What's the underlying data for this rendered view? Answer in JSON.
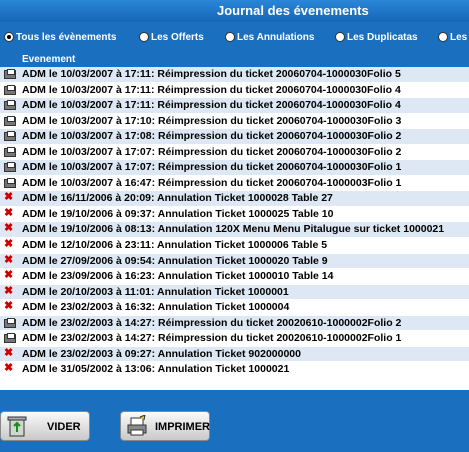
{
  "window": {
    "title": "Journal des évenements"
  },
  "filters": [
    {
      "label": "Tous les évènements",
      "selected": true
    },
    {
      "label": "Les Offerts",
      "selected": false
    },
    {
      "label": "Les Annulations",
      "selected": false
    },
    {
      "label": "Les Duplicatas",
      "selected": false
    },
    {
      "label": "Les",
      "selected": false
    }
  ],
  "list": {
    "header": "Evenement",
    "rows": [
      {
        "icon": "printer-icon",
        "text": "ADM le 10/03/2007 à 17:11: Réimpression du ticket 20060704-1000030Folio 5"
      },
      {
        "icon": "printer-icon",
        "text": "ADM le 10/03/2007 à 17:11: Réimpression du ticket 20060704-1000030Folio 4"
      },
      {
        "icon": "printer-icon",
        "text": "ADM le 10/03/2007 à 17:11: Réimpression du ticket 20060704-1000030Folio 4"
      },
      {
        "icon": "printer-icon",
        "text": "ADM le 10/03/2007 à 17:10: Réimpression du ticket 20060704-1000030Folio 3"
      },
      {
        "icon": "printer-icon",
        "text": "ADM le 10/03/2007 à 17:08: Réimpression du ticket 20060704-1000030Folio 2"
      },
      {
        "icon": "printer-icon",
        "text": "ADM le 10/03/2007 à 17:07: Réimpression du ticket 20060704-1000030Folio 2"
      },
      {
        "icon": "printer-icon",
        "text": "ADM le 10/03/2007 à 17:07: Réimpression du ticket 20060704-1000030Folio 1"
      },
      {
        "icon": "printer-icon",
        "text": "ADM le 10/03/2007 à 16:47: Réimpression du ticket 20060704-1000003Folio 1"
      },
      {
        "icon": "cross-icon",
        "text": "ADM le 16/11/2006 à 20:09: Annulation Ticket 1000028 Table 27"
      },
      {
        "icon": "cross-icon",
        "text": "ADM le 19/10/2006 à 09:37: Annulation Ticket 1000025 Table 10"
      },
      {
        "icon": "cross-icon",
        "text": "ADM le 19/10/2006 à 08:13: Annulation 120X Menu Menu Pitalugue sur ticket 1000021"
      },
      {
        "icon": "cross-icon",
        "text": "ADM le 12/10/2006 à 23:11: Annulation Ticket 1000006 Table 5"
      },
      {
        "icon": "cross-icon",
        "text": "ADM le 27/09/2006 à 09:54: Annulation Ticket 1000020 Table 9"
      },
      {
        "icon": "cross-icon",
        "text": "ADM le 23/09/2006 à 16:23: Annulation Ticket 1000010 Table 14"
      },
      {
        "icon": "cross-icon",
        "text": "ADM le 20/10/2003 à 11:01: Annulation Ticket 1000001"
      },
      {
        "icon": "cross-icon",
        "text": "ADM le 23/02/2003 à 16:32: Annulation Ticket 1000004"
      },
      {
        "icon": "printer-icon",
        "text": "ADM le 23/02/2003 à 14:27: Réimpression du ticket 20020610-1000002Folio 2"
      },
      {
        "icon": "printer-icon",
        "text": "ADM le 23/02/2003 à 14:27: Réimpression du ticket 20020610-1000002Folio 1"
      },
      {
        "icon": "cross-icon",
        "text": "ADM le 23/02/2003 à 09:27: Annulation Ticket 902000000"
      },
      {
        "icon": "cross-icon",
        "text": "ADM le 31/05/2002 à 13:06: Annulation Ticket 1000021"
      }
    ]
  },
  "buttons": {
    "clear_label": "VIDER",
    "print_label": "IMPRIMER"
  }
}
